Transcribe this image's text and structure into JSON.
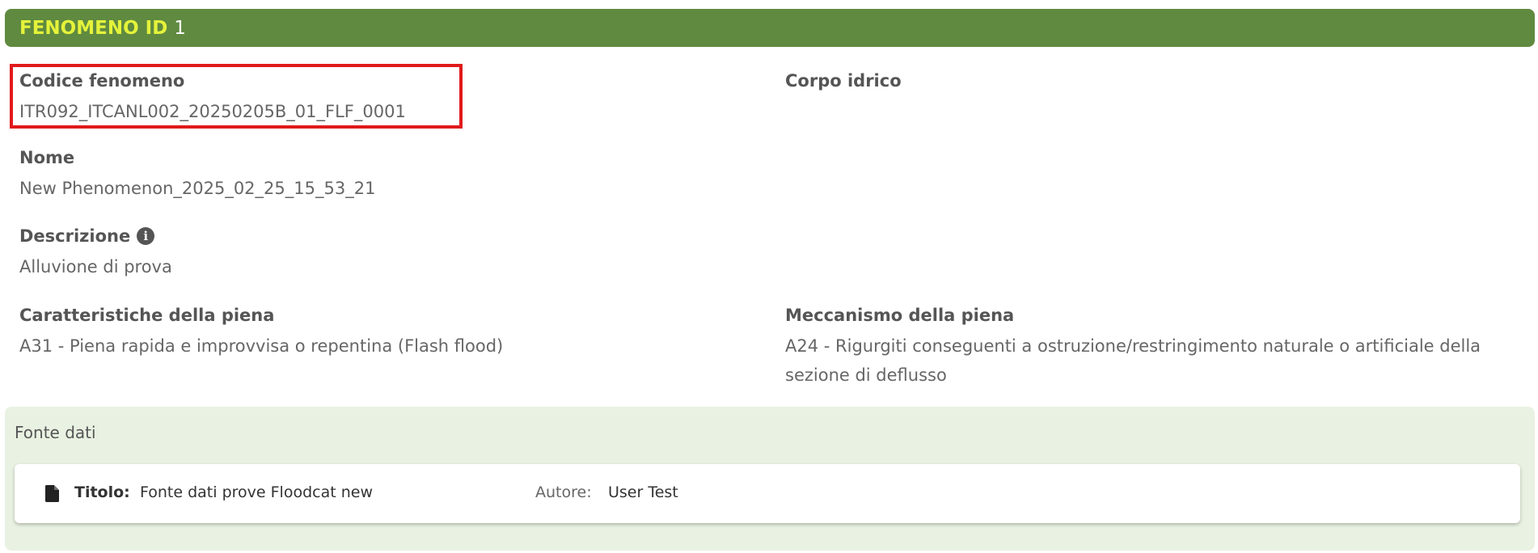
{
  "header": {
    "label": "FENOMENO ID",
    "id": "1"
  },
  "fields": {
    "codice": {
      "label": "Codice fenomeno",
      "value": "ITR092_ITCANL002_20250205B_01_FLF_0001"
    },
    "corpo_idrico": {
      "label": "Corpo idrico",
      "value": ""
    },
    "nome": {
      "label": "Nome",
      "value": "New Phenomenon_2025_02_25_15_53_21"
    },
    "descrizione": {
      "label": "Descrizione",
      "value": "Alluvione di prova",
      "icon": "info-icon"
    },
    "caratteristiche": {
      "label": "Caratteristiche della piena",
      "value": "A31 - Piena rapida e improvvisa o repentina (Flash flood)"
    },
    "meccanismo": {
      "label": "Meccanismo della piena",
      "value": "A24 - Rigurgiti conseguenti a ostruzione/restringimento naturale o artificiale della sezione di deflusso"
    }
  },
  "source": {
    "title": "Fonte dati",
    "item": {
      "icon": "document-icon",
      "titolo_label": "Titolo:",
      "titolo_value": "Fonte dati prove Floodcat new",
      "autore_label": "Autore:",
      "autore_value": "User Test"
    }
  },
  "colors": {
    "header_bg": "#5f8a40",
    "header_label": "#e4f23a",
    "highlight": "#e11a1a",
    "panel_bg": "#e9f2e2"
  }
}
